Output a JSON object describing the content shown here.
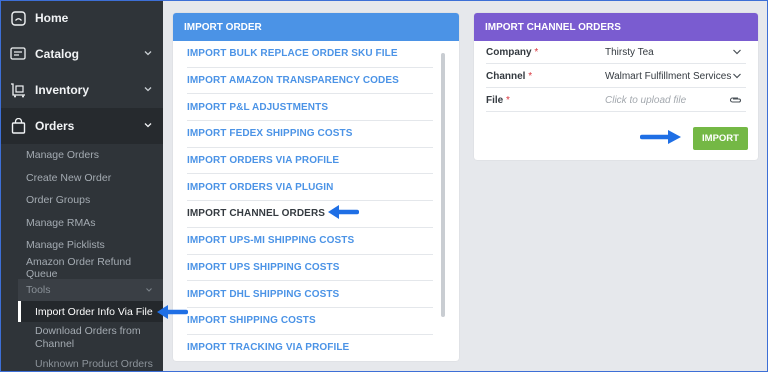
{
  "sidebar": {
    "nav": [
      {
        "label": "Home",
        "icon": "home-icon"
      },
      {
        "label": "Catalog",
        "icon": "catalog-icon"
      },
      {
        "label": "Inventory",
        "icon": "inventory-icon"
      },
      {
        "label": "Orders",
        "icon": "shopping-bag-icon"
      }
    ],
    "order_items": [
      "Manage Orders",
      "Create New Order",
      "Order Groups",
      "Manage RMAs",
      "Manage Picklists",
      "Amazon Order Refund Queue"
    ],
    "tools_label": "Tools",
    "tools_items": [
      "Import Order Info Via File",
      "Download Orders from Channel",
      "Unknown Product Orders"
    ]
  },
  "import_panel": {
    "title": "IMPORT ORDER",
    "items": [
      "IMPORT BULK REPLACE ORDER SKU FILE",
      "IMPORT AMAZON TRANSPARENCY CODES",
      "IMPORT P&L ADJUSTMENTS",
      "IMPORT FEDEX SHIPPING COSTS",
      "IMPORT ORDERS VIA PROFILE",
      "IMPORT ORDERS VIA PLUGIN",
      "IMPORT CHANNEL ORDERS",
      "IMPORT UPS-MI SHIPPING COSTS",
      "IMPORT UPS SHIPPING COSTS",
      "IMPORT DHL SHIPPING COSTS",
      "IMPORT SHIPPING COSTS",
      "IMPORT TRACKING VIA PROFILE"
    ],
    "selected_index": 6
  },
  "channel_panel": {
    "title": "IMPORT CHANNEL ORDERS",
    "company_label": "Company",
    "company_value": "Thirsty Tea",
    "channel_label": "Channel",
    "channel_value": "Walmart Fulfillment Services",
    "file_label": "File",
    "file_placeholder": "Click to upload file",
    "required_mark": "*",
    "import_button": "IMPORT"
  },
  "colors": {
    "sidebar_bg": "#2f3439",
    "import_header": "#4b93e6",
    "channel_header": "#7a5cd0",
    "import_button": "#74b845",
    "callout_arrow": "#1f6fe5"
  }
}
